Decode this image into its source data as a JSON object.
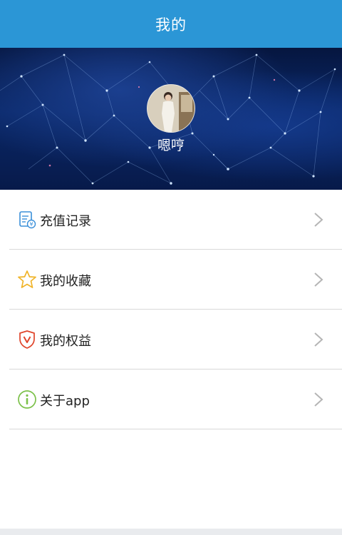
{
  "header": {
    "title": "我的"
  },
  "profile": {
    "username": "嗯哼"
  },
  "menu": {
    "items": [
      {
        "label": "充值记录",
        "icon": "recharge-record-icon",
        "icon_color": "#3a8fd9"
      },
      {
        "label": "我的收藏",
        "icon": "star-icon",
        "icon_color": "#f0b429"
      },
      {
        "label": "我的权益",
        "icon": "shield-v-icon",
        "icon_color": "#e0452b"
      },
      {
        "label": "关于app",
        "icon": "info-icon",
        "icon_color": "#7cc14a"
      }
    ]
  },
  "colors": {
    "header_bg": "#2b96d6",
    "divider": "#d9d9d9",
    "chevron": "#b5b5b5"
  }
}
